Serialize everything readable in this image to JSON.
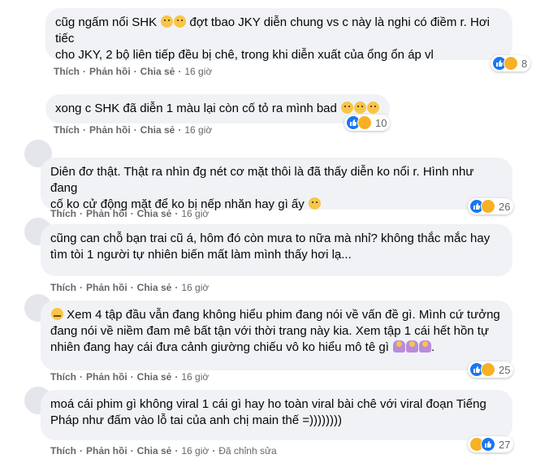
{
  "actions": {
    "like": "Thích",
    "reply": "Phản hồi",
    "share": "Chia sẻ",
    "edited": "Đã chỉnh sửa"
  },
  "comments": [
    {
      "line1": "cũg ngấm nổi SHK",
      "line1b": " đợt tbao JKY diễn chung vs c này là nghi có điềm r. Hơi tiếc",
      "line2": "cho JKY, 2 bộ liên tiếp đều bị chê, trong khi diễn xuất của ổng ổn áp vl",
      "time": "16 giờ",
      "reactions": [
        "like",
        "haha"
      ],
      "count": "8"
    },
    {
      "text": "xong c SHK đã diễn 1 màu lại còn cố tỏ ra mình bad",
      "time": "16 giờ",
      "reactions": [
        "like",
        "haha"
      ],
      "count": "10"
    },
    {
      "line1": "Diên đơ thật. Thật ra nhìn đg nét cơ mặt thôi là đã thấy diễn ko nổi r. Hình như đang",
      "line2": "cố ko cử động mặt để ko bị nếp nhăn hay gì ấy",
      "time": "16 giờ",
      "reactions": [
        "like",
        "haha"
      ],
      "count": "26"
    },
    {
      "line1": "cũng can chỗ bạn trai cũ á, hôm đó còn mưa to nữa mà nhỉ? không thắc mắc hay",
      "line2": "tìm tòi 1 người tự nhiên biến mất làm mình thấy hơi lạ...",
      "time": "16 giờ"
    },
    {
      "line1": " Xem 4 tập đầu vẫn đang không hiểu phim đang nói về vấn đề gì. Mình cứ tưởng",
      "line2": "đang nói về niềm đam mê bất tận với thời trang này kia. Xem tập 1 cái hết hồn tự",
      "line3": "nhiên đang hay cái đưa cảnh giường chiếu vô ko hiểu mô tê gì",
      "time": "16 giờ",
      "reactions": [
        "like",
        "haha"
      ],
      "count": "25"
    },
    {
      "line1": "moá cái phim gì không viral 1 cái gì hay ho toàn viral bài chê với viral đoạn Tiếng",
      "line2": "Pháp như đấm vào lỗ tai của anh chị main thế =))))))))",
      "time": "16 giờ",
      "reactions": [
        "haha",
        "like"
      ],
      "count": "27"
    }
  ]
}
